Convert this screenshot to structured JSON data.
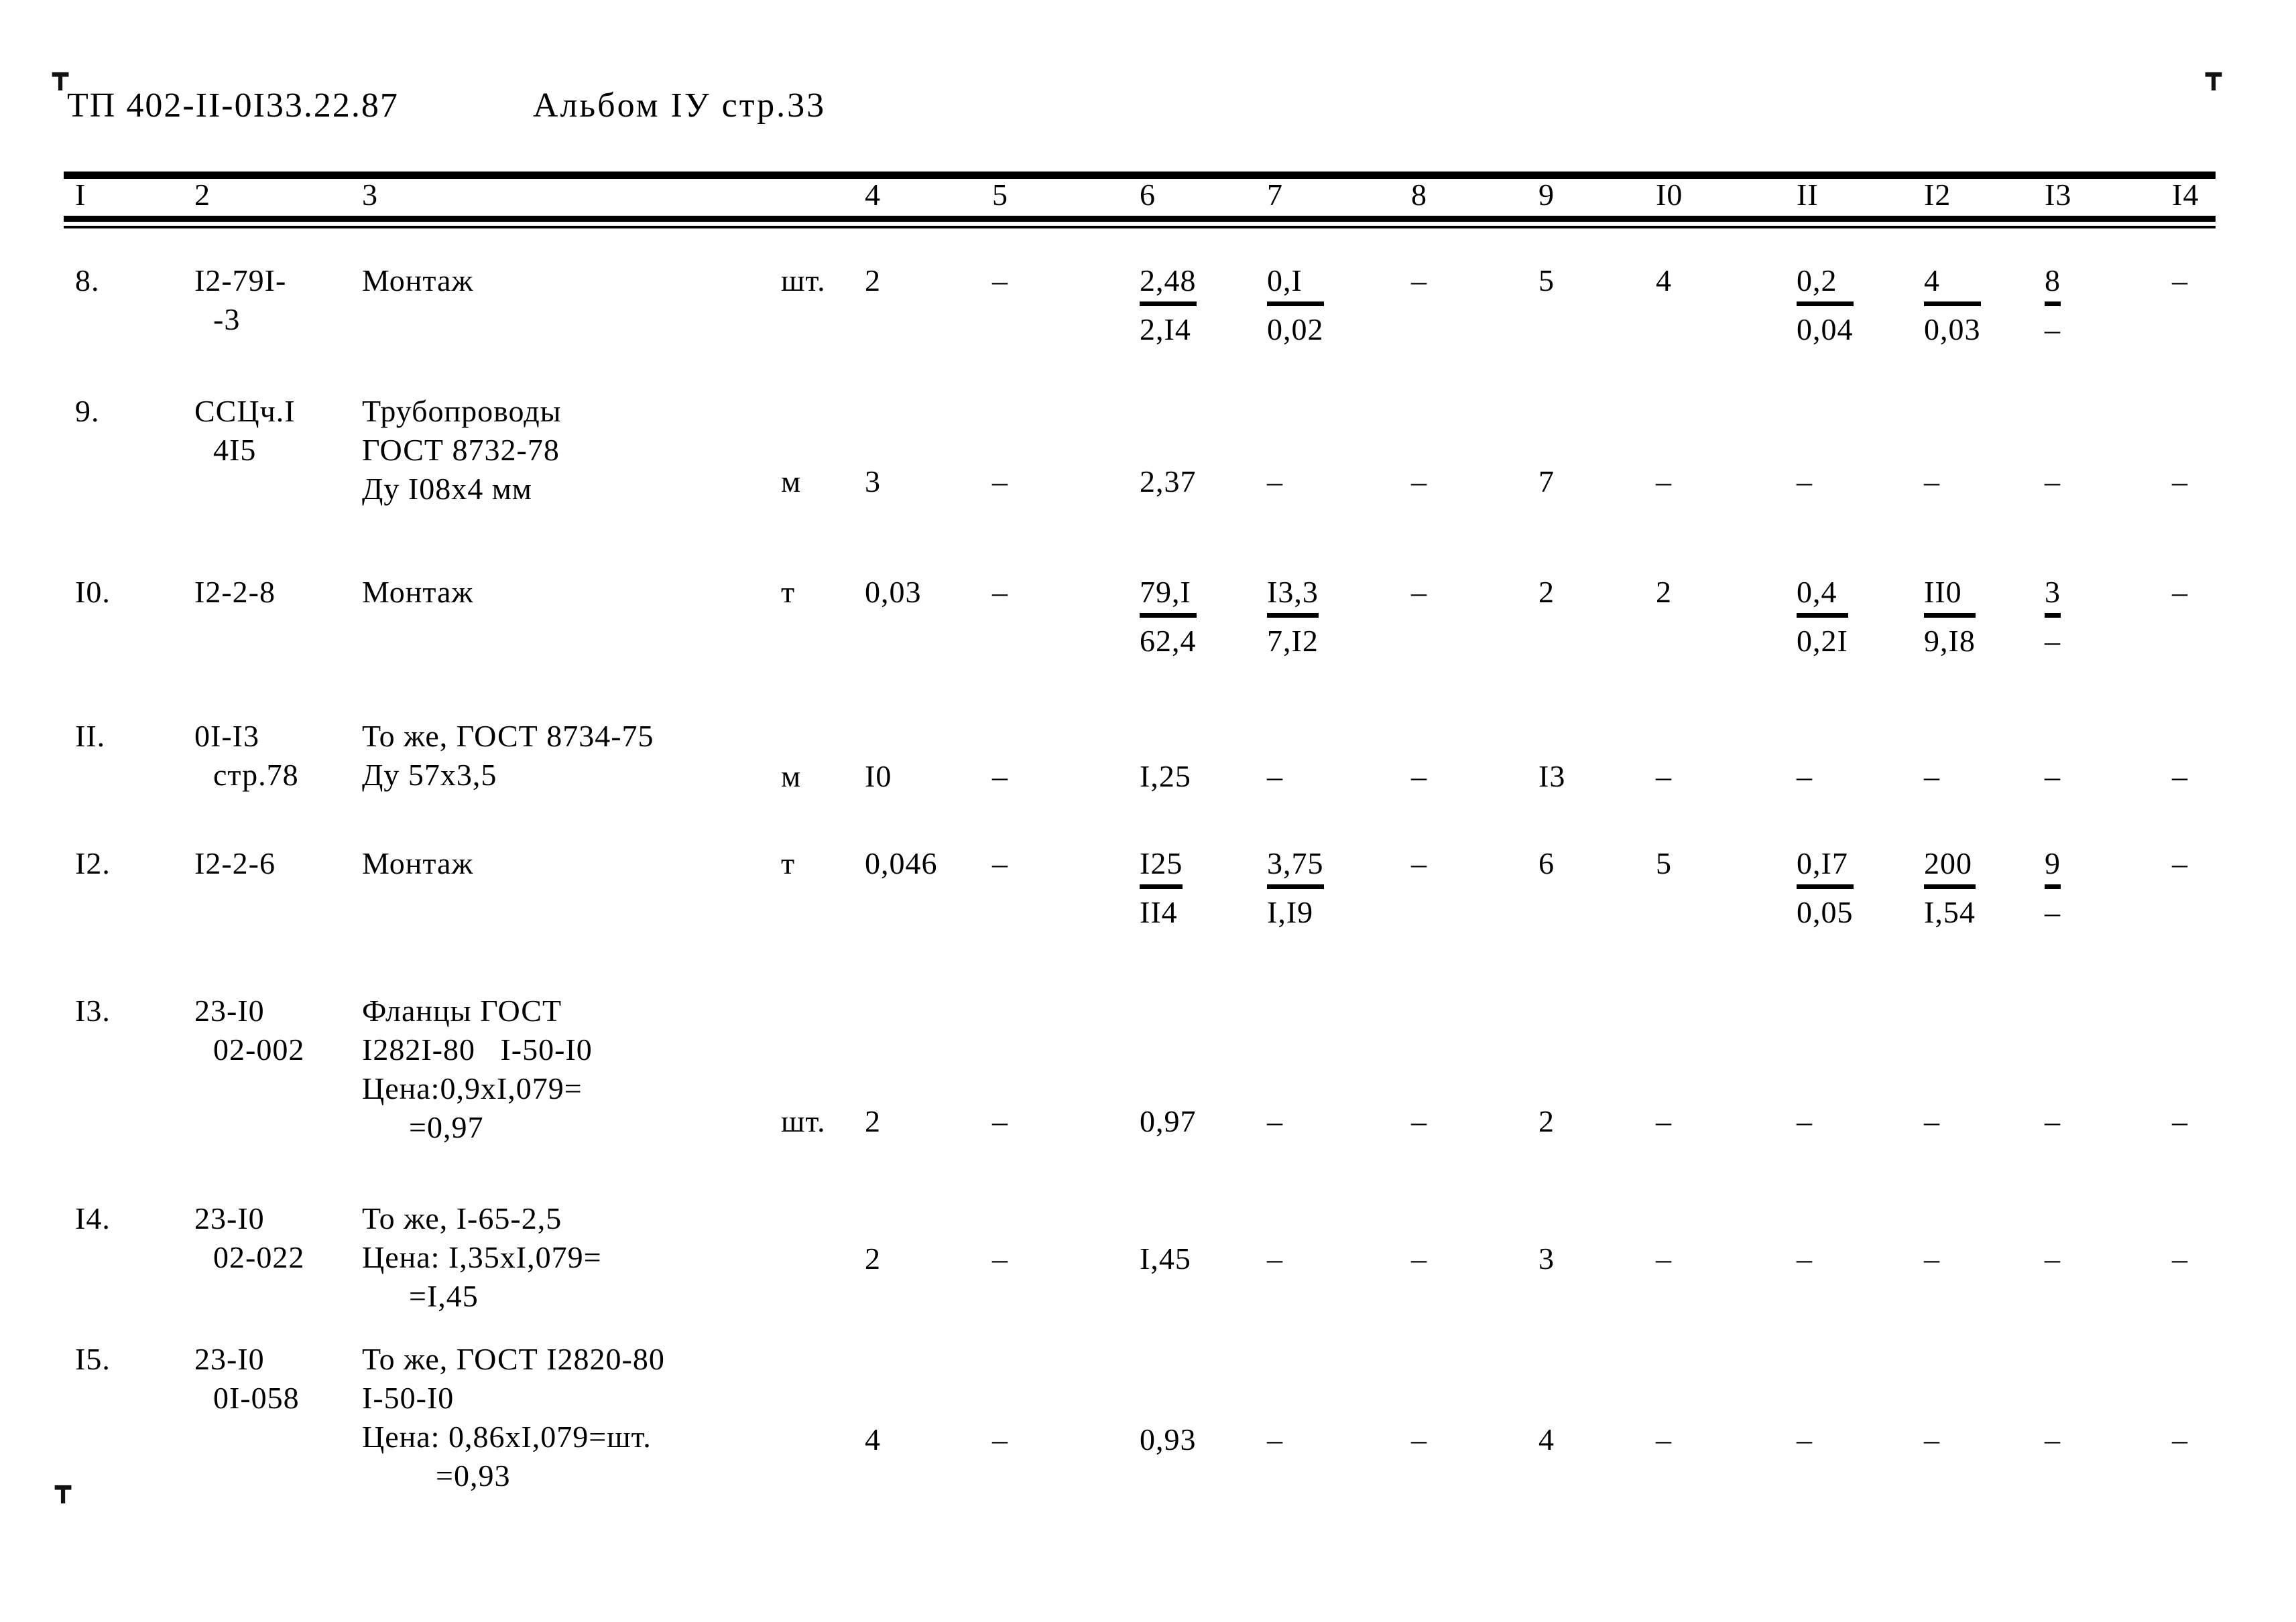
{
  "document": {
    "code": "ТП 402-II-0I33.22.87",
    "album": "Альбом IУ стр.33",
    "crop_mark_glyph": "┳"
  },
  "table": {
    "column_headers": [
      "I",
      "2",
      "3",
      "4",
      "5",
      "6",
      "7",
      "8",
      "9",
      "I0",
      "II",
      "I2",
      "I3",
      "I4"
    ],
    "dash": "–",
    "rows": [
      {
        "no": "8.",
        "code_l1": "I2-79I-",
        "code_l2": "-3",
        "desc_l1": "Монтаж",
        "desc_l2": "",
        "desc_l3": "",
        "desc_l4": "",
        "unit": "шт.",
        "c4": "2",
        "c5": "–",
        "c6_top": "2,48",
        "c6_bot": "2,I4",
        "c7_top": "0,I",
        "c7_bot": "0,02",
        "c8": "–",
        "c9": "5",
        "c10": "4",
        "c11_top": "0,2",
        "c11_bot": "0,04",
        "c12_top": "4",
        "c12_bot": "0,03",
        "c13_top": "8",
        "c13_bot": "–",
        "c14": "–"
      },
      {
        "no": "9.",
        "code_l1": "ССЦч.I",
        "code_l2": "4I5",
        "desc_l1": "Трубопроводы",
        "desc_l2": "ГОСТ 8732-78",
        "desc_l3": "Ду I08х4 мм",
        "desc_l4": "",
        "unit": "м",
        "c4": "3",
        "c5": "–",
        "c6_top": "2,37",
        "c6_bot": "",
        "c7_top": "–",
        "c7_bot": "",
        "c8": "–",
        "c9": "7",
        "c10": "–",
        "c11_top": "–",
        "c11_bot": "",
        "c12_top": "–",
        "c12_bot": "",
        "c13_top": "–",
        "c13_bot": "",
        "c14": "–"
      },
      {
        "no": "I0.",
        "code_l1": "I2-2-8",
        "code_l2": "",
        "desc_l1": "Монтаж",
        "desc_l2": "",
        "desc_l3": "",
        "desc_l4": "",
        "unit": "т",
        "c4": "0,03",
        "c5": "–",
        "c6_top": "79,I",
        "c6_bot": "62,4",
        "c7_top": "I3,3",
        "c7_bot": "7,I2",
        "c8": "–",
        "c9": "2",
        "c10": "2",
        "c11_top": "0,4",
        "c11_bot": "0,2I",
        "c12_top": "II0",
        "c12_bot": "9,I8",
        "c13_top": "3",
        "c13_bot": "–",
        "c14": "–"
      },
      {
        "no": "II.",
        "code_l1": "0I-I3",
        "code_l2": "стр.78",
        "desc_l1": "То же, ГОСТ 8734-75",
        "desc_l2": "Ду 57х3,5",
        "desc_l3": "",
        "desc_l4": "",
        "unit": "м",
        "c4": "I0",
        "c5": "–",
        "c6_top": "I,25",
        "c6_bot": "",
        "c7_top": "–",
        "c7_bot": "",
        "c8": "–",
        "c9": "I3",
        "c10": "–",
        "c11_top": "–",
        "c11_bot": "",
        "c12_top": "–",
        "c12_bot": "",
        "c13_top": "–",
        "c13_bot": "",
        "c14": "–"
      },
      {
        "no": "I2.",
        "code_l1": "I2-2-6",
        "code_l2": "",
        "desc_l1": "Монтаж",
        "desc_l2": "",
        "desc_l3": "",
        "desc_l4": "",
        "unit": "т",
        "c4": "0,046",
        "c5": "–",
        "c6_top": "I25",
        "c6_bot": "II4",
        "c7_top": "3,75",
        "c7_bot": "I,I9",
        "c8": "–",
        "c9": "6",
        "c10": "5",
        "c11_top": "0,I7",
        "c11_bot": "0,05",
        "c12_top": "200",
        "c12_bot": "I,54",
        "c13_top": "9",
        "c13_bot": "–",
        "c14": "–"
      },
      {
        "no": "I3.",
        "code_l1": "23-I0",
        "code_l2": "02-002",
        "desc_l1": "Фланцы ГОСТ",
        "desc_l2": "I282I-80   I-50-I0",
        "desc_l3": "Цена:0,9хI,079=",
        "desc_l4": "=0,97",
        "unit": "шт.",
        "c4": "2",
        "c5": "–",
        "c6_top": "0,97",
        "c6_bot": "",
        "c7_top": "–",
        "c7_bot": "",
        "c8": "–",
        "c9": "2",
        "c10": "–",
        "c11_top": "–",
        "c11_bot": "",
        "c12_top": "–",
        "c12_bot": "",
        "c13_top": "–",
        "c13_bot": "",
        "c14": "–"
      },
      {
        "no": "I4.",
        "code_l1": "23-I0",
        "code_l2": "02-022",
        "desc_l1": "То же, I-65-2,5",
        "desc_l2": "Цена: I,35хI,079=",
        "desc_l3": "=I,45",
        "desc_l4": "",
        "unit": "",
        "c4": "2",
        "c5": "–",
        "c6_top": "I,45",
        "c6_bot": "",
        "c7_top": "–",
        "c7_bot": "",
        "c8": "–",
        "c9": "3",
        "c10": "–",
        "c11_top": "–",
        "c11_bot": "",
        "c12_top": "–",
        "c12_bot": "",
        "c13_top": "–",
        "c13_bot": "",
        "c14": "–"
      },
      {
        "no": "I5.",
        "code_l1": "23-I0",
        "code_l2": "0I-058",
        "desc_l1": "То же, ГОСТ I2820-80",
        "desc_l2": "I-50-I0",
        "desc_l3": "Цена: 0,86хI,079=шт.",
        "desc_l4": "=0,93",
        "unit": "",
        "c4": "4",
        "c5": "–",
        "c6_top": "0,93",
        "c6_bot": "",
        "c7_top": "–",
        "c7_bot": "",
        "c8": "–",
        "c9": "4",
        "c10": "–",
        "c11_top": "–",
        "c11_bot": "",
        "c12_top": "–",
        "c12_bot": "",
        "c13_top": "–",
        "c13_bot": "",
        "c14": "–"
      }
    ]
  }
}
